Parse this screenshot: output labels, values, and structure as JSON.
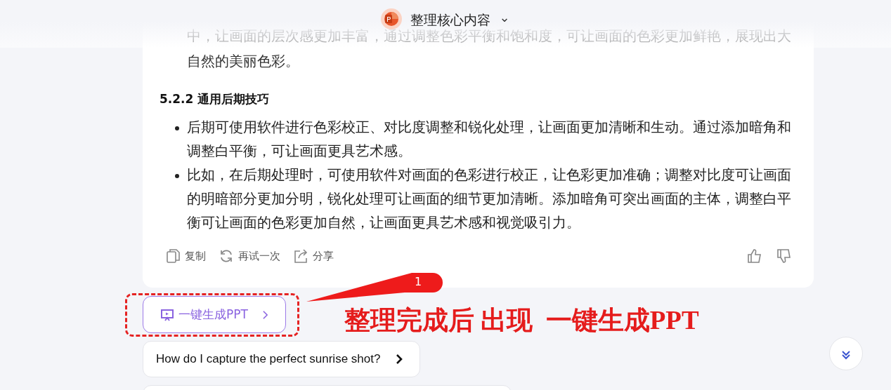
{
  "header": {
    "title": "整理核心内容",
    "chevron": "⌄"
  },
  "answer": {
    "intro": "中，让画面的层次感更加丰富，通过调整色彩平衡和饱和度，可让画面的色彩更加鲜艳，展现出大自然的美丽色彩。",
    "heading": "5.2.2 通用后期技巧",
    "bullets": [
      "后期可使用软件进行色彩校正、对比度调整和锐化处理，让画面更加清晰和生动。通过添加暗角和调整白平衡，可让画面更具艺术感。",
      "比如，在后期处理时，可使用软件对画面的色彩进行校正，让色彩更加准确；调整对比度可让画面的明暗部分更加分明，锐化处理可让画面的细节更加清晰。添加暗角可突出画面的主体，调整白平衡可让画面的色彩更加自然，让画面更具艺术感和视觉吸引力。"
    ],
    "actions": [
      {
        "kind": "copy",
        "label": "复制"
      },
      {
        "kind": "retry",
        "label": "再试一次"
      },
      {
        "kind": "share",
        "label": "分享"
      }
    ]
  },
  "ppt_button": {
    "label": "一键生成PPT"
  },
  "suggestions": [
    {
      "text": "How do I capture the perfect sunrise shot?"
    }
  ],
  "annotation": {
    "number": "1",
    "note": "整理完成后 出现  一键生成PPT"
  }
}
